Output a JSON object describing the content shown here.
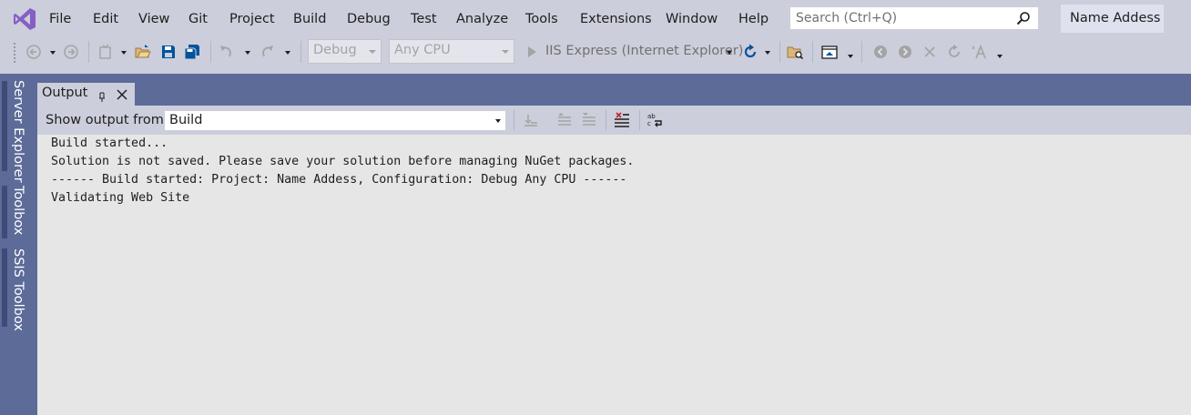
{
  "menu": {
    "items": [
      "File",
      "Edit",
      "View",
      "Git",
      "Project",
      "Build",
      "Debug",
      "Test",
      "Analyze",
      "Tools",
      "Extensions",
      "Window",
      "Help"
    ]
  },
  "search": {
    "placeholder": "Search (Ctrl+Q)"
  },
  "account": {
    "name": "Name Addess"
  },
  "toolbar": {
    "configuration": "Debug",
    "platform": "Any CPU",
    "run_target": "IIS Express (Internet Explorer)",
    "icons": [
      "back-icon",
      "forward-icon",
      "new-project-icon",
      "open-folder-icon",
      "save-icon",
      "save-all-icon",
      "undo-icon",
      "redo-icon",
      "play-icon",
      "refresh-icon",
      "find-in-files-icon",
      "browser-link-icon",
      "nav-back-icon",
      "nav-forward-icon",
      "stop-icon",
      "reload-icon",
      "font-size-icon"
    ]
  },
  "side_tabs": [
    "Server Explorer",
    "Toolbox",
    "SSIS Toolbox"
  ],
  "output": {
    "title": "Output",
    "show_output_from_label": "Show output from:",
    "source": "Build",
    "lines": [
      "Build started...",
      "Solution is not saved. Please save your solution before managing NuGet packages.",
      "------ Build started: Project: Name Addess, Configuration: Debug Any CPU ------",
      "Validating Web Site"
    ]
  },
  "colors": {
    "chrome": "#cccedb",
    "accent_frame": "#5d6b99",
    "vs_purple": "#865fc5",
    "save_blue": "#00539c",
    "output_bg": "#e6e6e6"
  }
}
